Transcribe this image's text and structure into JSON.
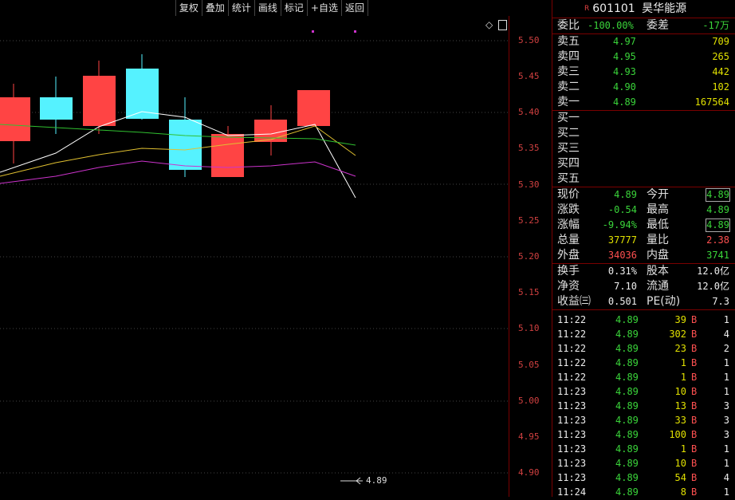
{
  "toolbar": {
    "items": [
      "复权",
      "叠加",
      "统计",
      "画线",
      "标记",
      "+自选",
      "返回"
    ]
  },
  "yaxis": {
    "labels": [
      "5.50",
      "5.45",
      "5.40",
      "5.35",
      "5.30",
      "5.25",
      "5.20",
      "5.15",
      "5.10",
      "5.05",
      "5.00",
      "4.95",
      "4.90"
    ]
  },
  "price_marker": {
    "text": "4.89"
  },
  "colors": {
    "up": "#ff4444",
    "down": "#55f2ff",
    "ma5": "#ffffff",
    "ma10": "#e0c030",
    "ma20": "#30c030",
    "ma30": "#cc33cc"
  },
  "stock": {
    "code": "601101",
    "name": "昊华能源",
    "badge": "R"
  },
  "ratio": {
    "label1": "委比",
    "value1": "-100.00%",
    "label2": "委差",
    "value2": "-17万"
  },
  "asks": [
    {
      "label": "卖五",
      "price": "4.97",
      "vol": "709"
    },
    {
      "label": "卖四",
      "price": "4.95",
      "vol": "265"
    },
    {
      "label": "卖三",
      "price": "4.93",
      "vol": "442"
    },
    {
      "label": "卖二",
      "price": "4.90",
      "vol": "102"
    },
    {
      "label": "卖一",
      "price": "4.89",
      "vol": "167564"
    }
  ],
  "bids": [
    {
      "label": "买一"
    },
    {
      "label": "买二"
    },
    {
      "label": "买三"
    },
    {
      "label": "买四"
    },
    {
      "label": "买五"
    }
  ],
  "quote": [
    {
      "l1": "现价",
      "v1": "4.89",
      "l2": "今开",
      "v2": "4.89"
    },
    {
      "l1": "涨跌",
      "v1": "-0.54",
      "l2": "最高",
      "v2": "4.89"
    },
    {
      "l1": "涨幅",
      "v1": "-9.94%",
      "l2": "最低",
      "v2": "4.89"
    },
    {
      "l1": "总量",
      "v1": "37777",
      "l2": "量比",
      "v2": "2.38"
    },
    {
      "l1": "外盘",
      "v1": "34036",
      "l2": "内盘",
      "v2": "3741"
    }
  ],
  "info": [
    {
      "l1": "换手",
      "v1": "0.31%",
      "l2": "股本",
      "v2": "12.0亿"
    },
    {
      "l1": "净资",
      "v1": "7.10",
      "l2": "流通",
      "v2": "12.0亿"
    },
    {
      "l1": "收益㈢",
      "v1": "0.501",
      "l2": "PE(动)",
      "v2": "7.3"
    }
  ],
  "ticks": [
    {
      "time": "11:22",
      "price": "4.89",
      "vol": "39",
      "side": "B",
      "n": "1"
    },
    {
      "time": "11:22",
      "price": "4.89",
      "vol": "302",
      "side": "B",
      "n": "4"
    },
    {
      "time": "11:22",
      "price": "4.89",
      "vol": "23",
      "side": "B",
      "n": "2"
    },
    {
      "time": "11:22",
      "price": "4.89",
      "vol": "1",
      "side": "B",
      "n": "1"
    },
    {
      "time": "11:22",
      "price": "4.89",
      "vol": "1",
      "side": "B",
      "n": "1"
    },
    {
      "time": "11:23",
      "price": "4.89",
      "vol": "10",
      "side": "B",
      "n": "1"
    },
    {
      "time": "11:23",
      "price": "4.89",
      "vol": "13",
      "side": "B",
      "n": "3"
    },
    {
      "time": "11:23",
      "price": "4.89",
      "vol": "33",
      "side": "B",
      "n": "3"
    },
    {
      "time": "11:23",
      "price": "4.89",
      "vol": "100",
      "side": "B",
      "n": "3"
    },
    {
      "time": "11:23",
      "price": "4.89",
      "vol": "1",
      "side": "B",
      "n": "1"
    },
    {
      "time": "11:23",
      "price": "4.89",
      "vol": "10",
      "side": "B",
      "n": "1"
    },
    {
      "time": "11:23",
      "price": "4.89",
      "vol": "54",
      "side": "B",
      "n": "4"
    },
    {
      "time": "11:24",
      "price": "4.89",
      "vol": "8",
      "side": "B",
      "n": "1"
    }
  ]
}
